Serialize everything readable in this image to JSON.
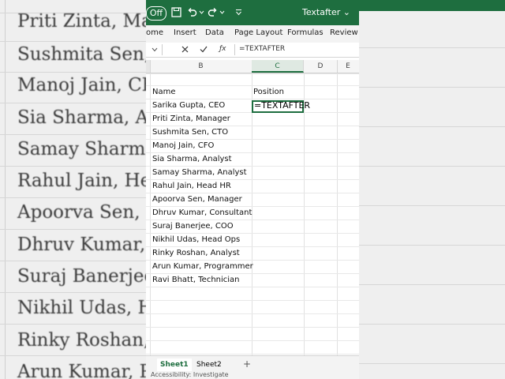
{
  "background": {
    "left_names": [
      "Priti Zinta, Ma",
      "Sushmita Sen,",
      "Manoj Jain, CF",
      "Sia Sharma, A",
      "Samay Sharma",
      "Rahul Jain, He",
      "Apoorva Sen,",
      "Dhruv Kumar, C",
      "Suraj Banerjee",
      "Nikhil Udas, H",
      "Rinky Roshan,",
      "Arun Kumar, P"
    ]
  },
  "titlebar": {
    "autosave": "Off",
    "workbook_title": "Textafter ⌄"
  },
  "ribbon": {
    "tabs": [
      "ome",
      "Insert",
      "Data",
      "Page Layout",
      "Formulas",
      "Review"
    ]
  },
  "formula_bar": {
    "formula": "=TEXTAFTER"
  },
  "columns": [
    "B",
    "C",
    "D",
    "E"
  ],
  "sheet": {
    "header_name": "Name",
    "header_position": "Position",
    "active_cell_text": "=TEXTAFTER",
    "names": [
      "Sarika Gupta, CEO",
      "Priti Zinta, Manager",
      "Sushmita Sen, CTO",
      "Manoj Jain, CFO",
      "Sia Sharma, Analyst",
      "Samay Sharma, Analyst",
      "Rahul Jain, Head HR",
      "Apoorva Sen, Manager",
      "Dhruv Kumar, Consultant",
      "Suraj Banerjee, COO",
      "Nikhil Udas, Head Ops",
      "Rinky Roshan, Analyst",
      "Arun Kumar, Programmer",
      "Ravi Bhatt, Technician"
    ]
  },
  "tabs": {
    "sheet1": "Sheet1",
    "sheet2": "Sheet2",
    "add": "+"
  },
  "status": {
    "text": "Accessibility: Investigate"
  },
  "colors": {
    "excel_green": "#1e6e3f"
  }
}
